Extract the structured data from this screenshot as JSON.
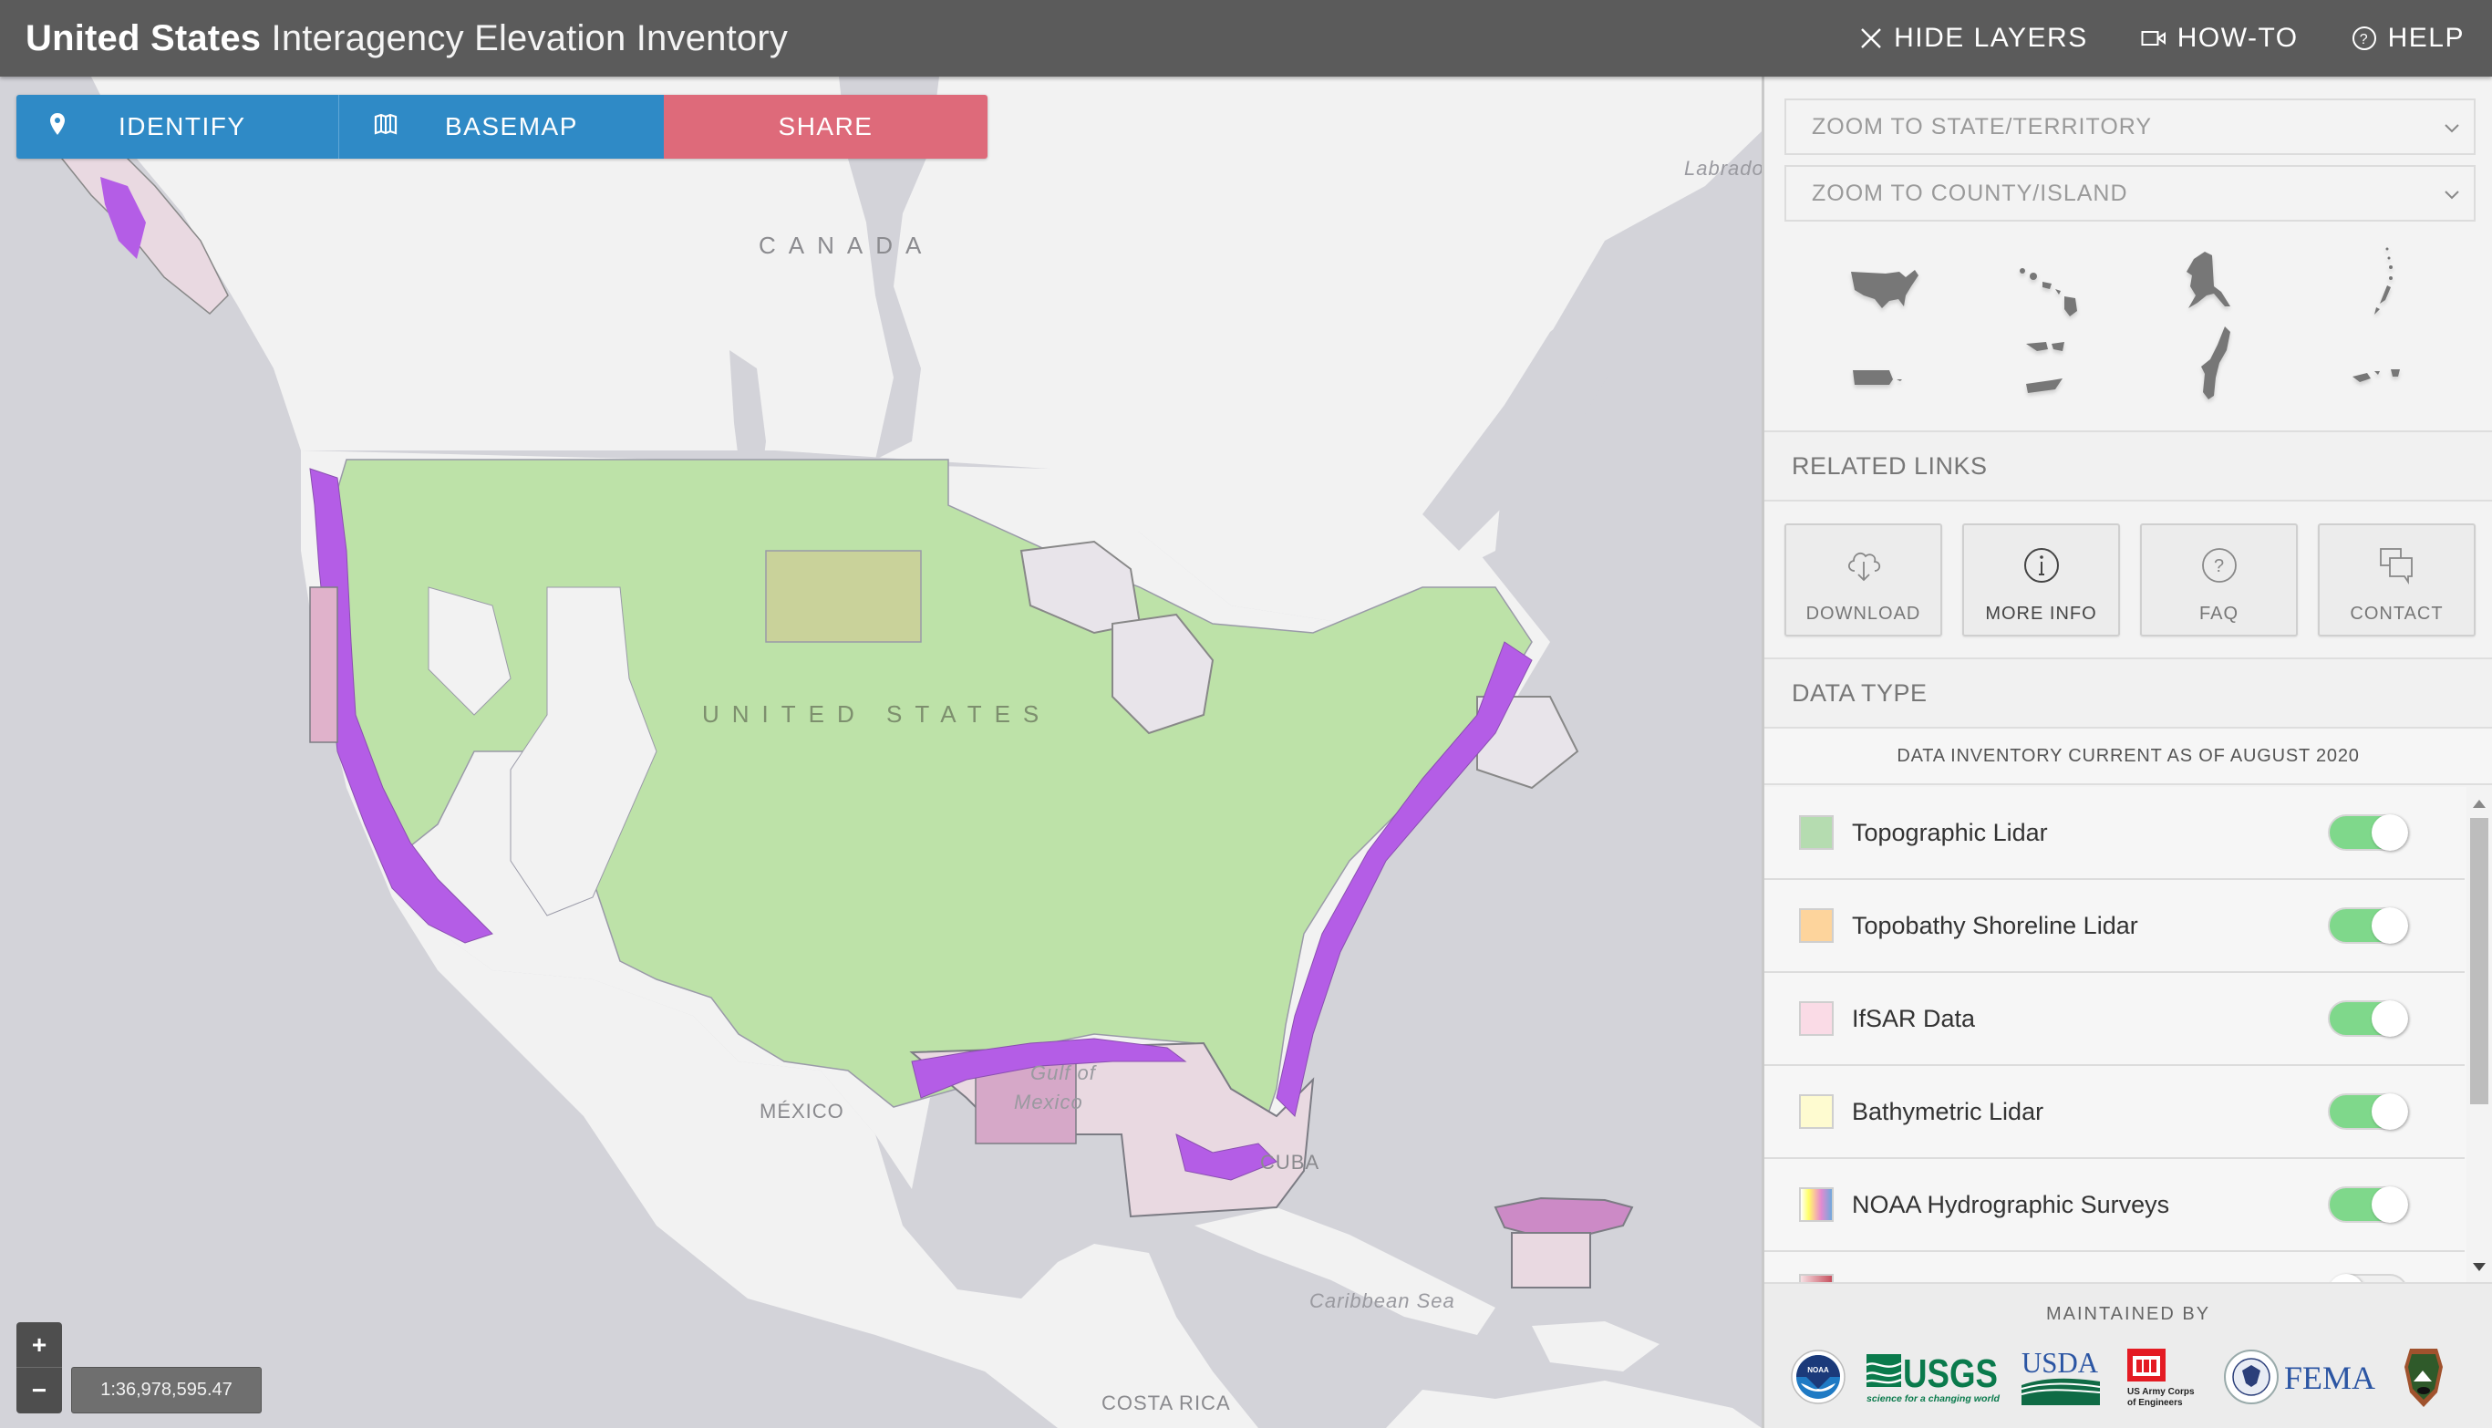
{
  "header": {
    "title_bold": "United States",
    "title_light": "Interagency Elevation Inventory",
    "actions": [
      {
        "label": "HIDE LAYERS",
        "icon": "close-icon"
      },
      {
        "label": "HOW-TO",
        "icon": "video-camera-icon"
      },
      {
        "label": "HELP",
        "icon": "help-circle-icon"
      }
    ]
  },
  "toolbar": {
    "identify_label": "IDENTIFY",
    "identify_icon": "map-pin-icon",
    "basemap_label": "BASEMAP",
    "basemap_icon": "map-fold-icon",
    "share_label": "SHARE"
  },
  "map": {
    "labels": {
      "canada": "CANADA",
      "united_states": "UNITED STATES",
      "mexico": "MÉXICO",
      "cuba": "CUBA",
      "caribbean_sea": "Caribbean Sea",
      "costa_rica": "COSTA RICA",
      "gulf_of_mexico_line1": "Gulf of",
      "gulf_of_mexico_line2": "Mexico",
      "labrador": "Labrado"
    },
    "zoom_in": "+",
    "zoom_out": "−",
    "scale": "1:36,978,595.47",
    "colors": {
      "water": "#d3d3d9",
      "land": "#f2f2f2",
      "topographic_lidar": "#b9e4a6",
      "ifsar": "#e7d2dc",
      "hydrographic": "#b45de6"
    }
  },
  "panel": {
    "zoom_state_placeholder": "ZOOM TO STATE/TERRITORY",
    "zoom_county_placeholder": "ZOOM TO COUNTY/ISLAND",
    "regions": [
      {
        "name": "Conterminous US"
      },
      {
        "name": "Hawaii"
      },
      {
        "name": "Alaska"
      },
      {
        "name": "Northern Mariana Islands"
      },
      {
        "name": "Puerto Rico"
      },
      {
        "name": "US Virgin Islands"
      },
      {
        "name": "Guam"
      },
      {
        "name": "American Samoa"
      }
    ],
    "related_links_title": "RELATED LINKS",
    "related_links": [
      {
        "label": "DOWNLOAD",
        "icon": "cloud-download-icon"
      },
      {
        "label": "MORE INFO",
        "icon": "info-circle-icon"
      },
      {
        "label": "FAQ",
        "icon": "question-circle-icon"
      },
      {
        "label": "CONTACT",
        "icon": "chat-bubbles-icon"
      }
    ],
    "data_type_title": "DATA TYPE",
    "inventory_note": "DATA INVENTORY CURRENT AS OF AUGUST 2020",
    "layers": [
      {
        "label": "Topographic Lidar",
        "color": "#b5dcb0",
        "enabled": true
      },
      {
        "label": "Topobathy Shoreline Lidar",
        "color": "#fdd49c",
        "enabled": true
      },
      {
        "label": "IfSAR Data",
        "color": "#fadbe6",
        "enabled": true
      },
      {
        "label": "Bathymetric Lidar",
        "color": "#fefbd0",
        "enabled": true
      },
      {
        "label": "NOAA Hydrographic Surveys",
        "color": "gradient",
        "enabled": true
      },
      {
        "label": "",
        "color": "gradient-red",
        "enabled": false
      }
    ],
    "maintained_by": "MAINTAINED BY",
    "agencies": [
      {
        "name": "NOAA"
      },
      {
        "name": "USGS",
        "tagline": "science for a changing world"
      },
      {
        "name": "USDA"
      },
      {
        "name": "US Army Corps of Engineers"
      },
      {
        "name": "FEMA"
      },
      {
        "name": "National Park Service"
      }
    ]
  }
}
